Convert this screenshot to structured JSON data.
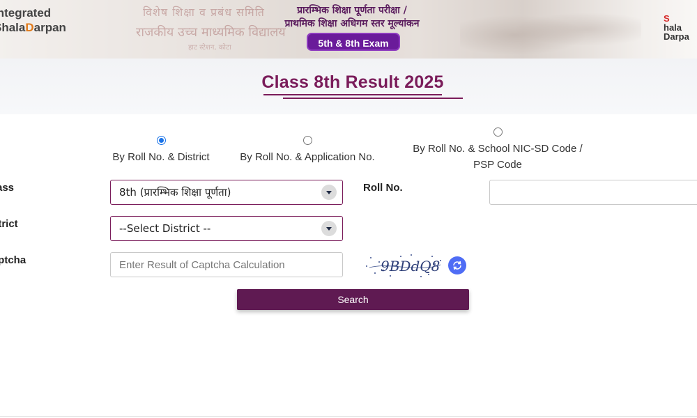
{
  "header": {
    "logo_left_line1": "Integrated",
    "logo_left_line2_prefix": "Shala",
    "logo_left_line2_accent": "D",
    "logo_left_line2_suffix": "arpan",
    "hindi_line1": "प्रारम्भिक शिक्षा पूर्णता परीक्षा /",
    "hindi_line2": "प्राथमिक शिक्षा अधिगम स्तर मूल्यांकन",
    "exam_badge": "5th & 8th Exam",
    "logo_right_line1_s": "S",
    "logo_right_line1": "hala",
    "logo_right_line2": "Darpa",
    "banner_bg_line1": "विशेष शिक्षा व प्रबंध समिति",
    "banner_bg_line2": "राजकीय उच्च माध्यमिक विद्यालय",
    "banner_bg_line3": "हाट स्टेशन, कोटा"
  },
  "page": {
    "title": "Class 8th Result 2025"
  },
  "search_modes": [
    {
      "label": "By Roll No. & District",
      "checked": true
    },
    {
      "label": "By Roll No. & Application No.",
      "checked": false
    },
    {
      "label_line1": "By Roll No. & School NIC-SD Code /",
      "label_line2": "PSP Code",
      "checked": false
    }
  ],
  "form": {
    "class_label": "Class",
    "class_value": "8th (प्रारम्भिक शिक्षा पूर्णता)",
    "district_label": "District",
    "district_value": "--Select District --",
    "captcha_label": "Captcha",
    "captcha_placeholder": "Enter Result of Captcha Calculation",
    "captcha_text": "9BDdQ8",
    "roll_label": "Roll No.",
    "roll_value": "",
    "search_label": "Search"
  },
  "colors": {
    "brand": "#7a1c5a",
    "button": "#5f1a52",
    "exam_badge": "#6a1b9a",
    "refresh": "#4f6df5",
    "radio_checked": "#1a73e8"
  }
}
